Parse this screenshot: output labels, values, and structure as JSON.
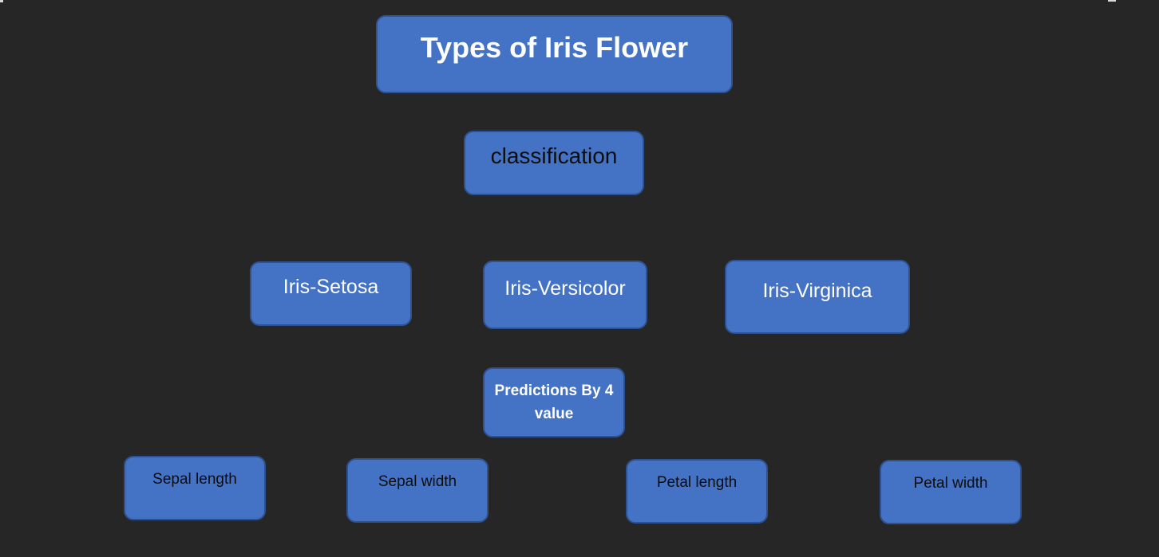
{
  "diagram": {
    "title": "Types of Iris Flower",
    "task": "classification",
    "species": [
      {
        "label": "Iris-Setosa"
      },
      {
        "label": "Iris-Versicolor"
      },
      {
        "label": "Iris-Virginica"
      }
    ],
    "prediction": "Predictions By 4 value",
    "features": [
      {
        "label": "Sepal length"
      },
      {
        "label": "Sepal width"
      },
      {
        "label": "Petal length"
      },
      {
        "label": "Petal width"
      }
    ]
  },
  "colors": {
    "background": "#262626",
    "node_fill": "#4472c4",
    "node_border": "#2f528f"
  }
}
